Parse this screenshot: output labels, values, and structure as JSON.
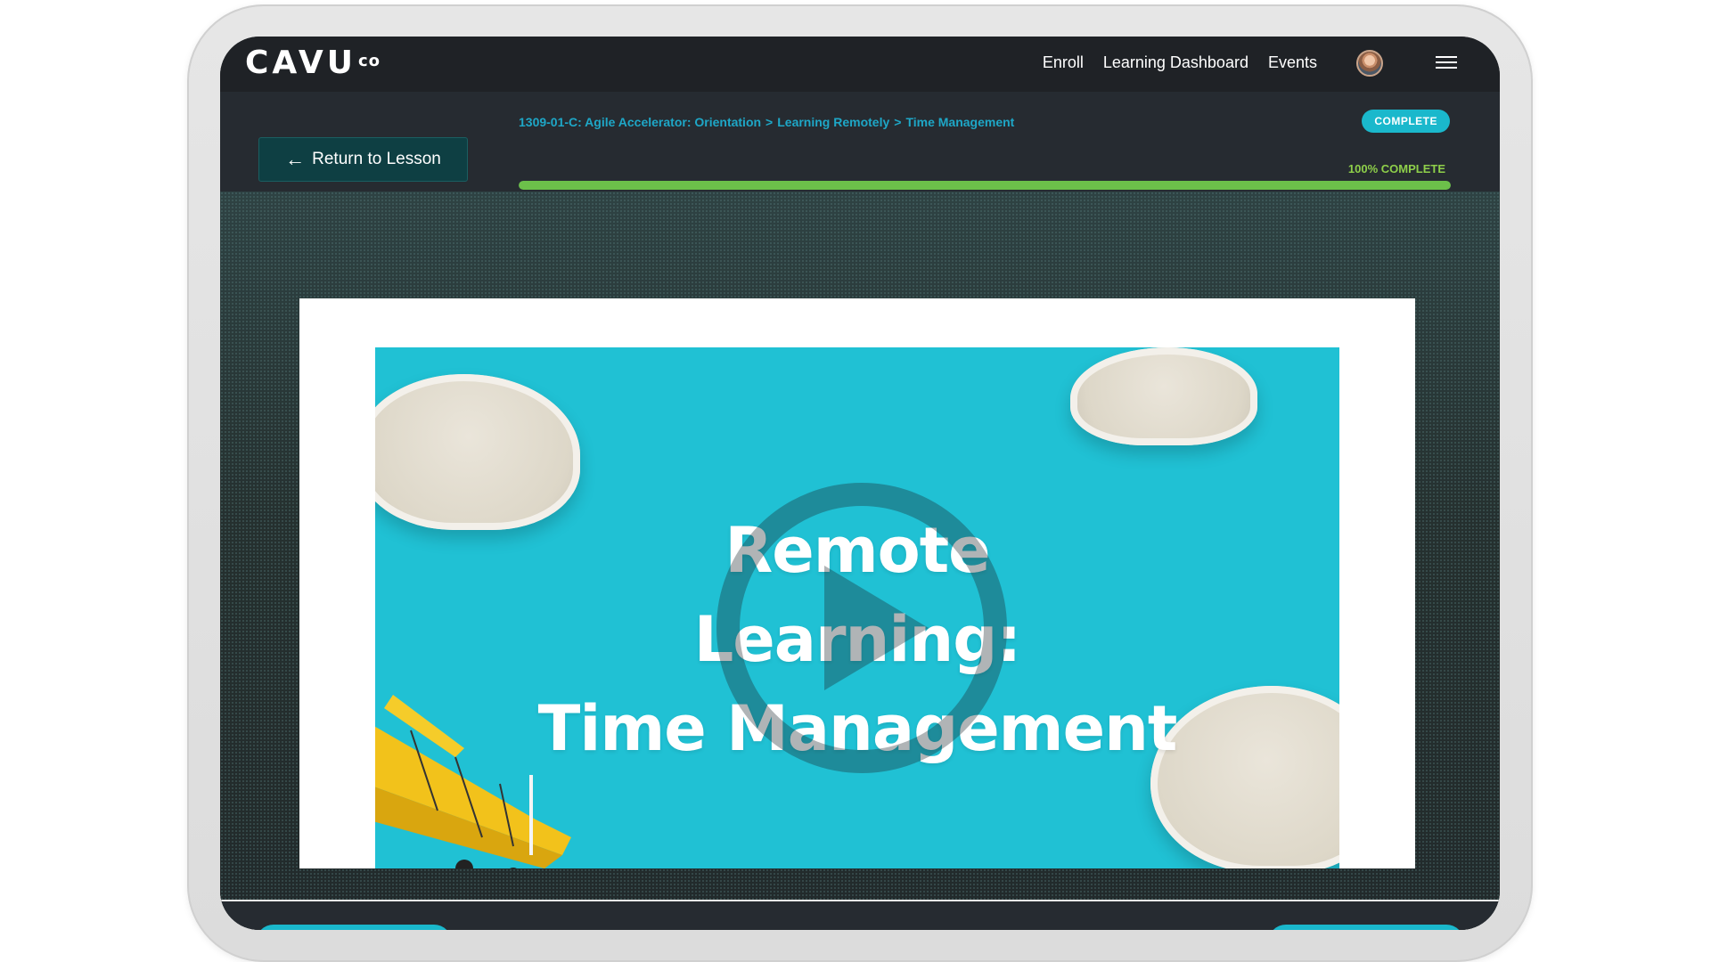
{
  "brand": {
    "logo": "CAVU",
    "logo_sup": "co"
  },
  "nav": {
    "links": [
      "Enroll",
      "Learning Dashboard",
      "Events"
    ]
  },
  "header": {
    "return_label": "Return to Lesson",
    "breadcrumb": [
      "1309-01-C: Agile Accelerator: Orientation",
      "Learning Remotely",
      "Time Management"
    ],
    "status_badge": "COMPLETE",
    "progress_label": "100% COMPLETE",
    "progress_value": 100
  },
  "video": {
    "title_lines": [
      "Remote",
      "Learning:",
      "Time Management"
    ]
  },
  "colors": {
    "accent": "#1ab8cc",
    "breadcrumb": "#1ea7c7",
    "progress": "#6cc04a",
    "video_bg": "#20c1d4"
  }
}
